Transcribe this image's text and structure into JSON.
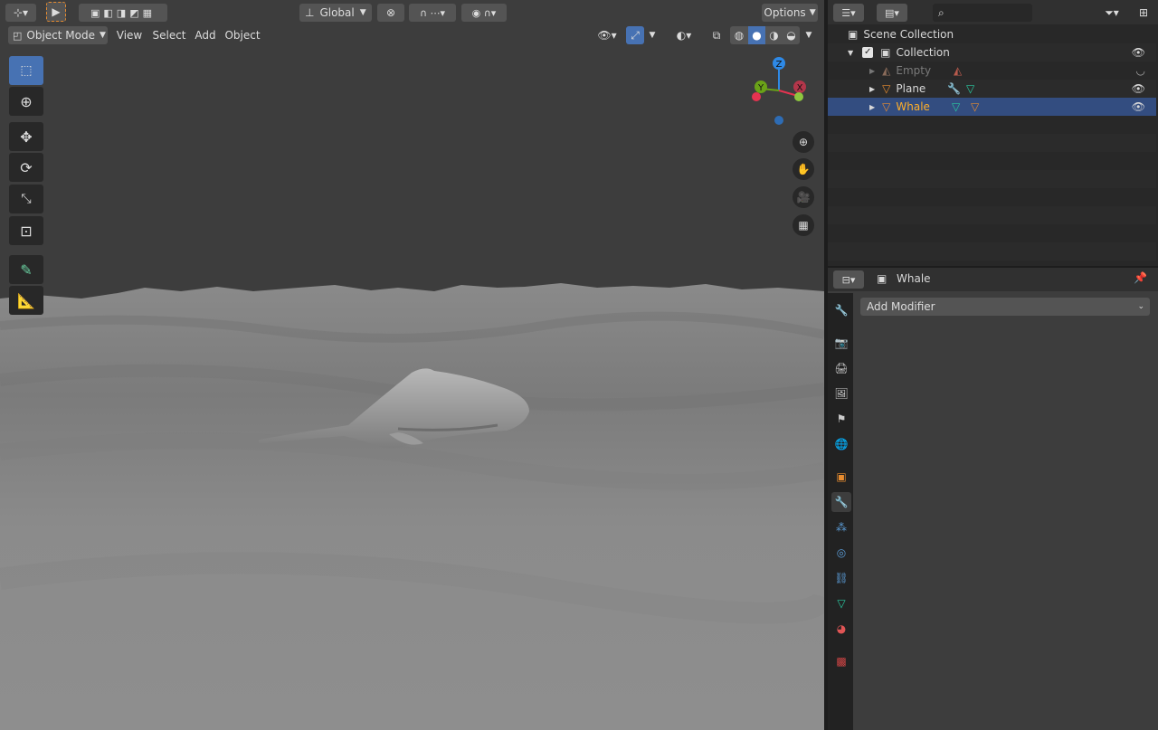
{
  "viewport": {
    "header": {
      "global_label": "Global",
      "options_label": "Options",
      "mode_label": "Object Mode",
      "menus": [
        "View",
        "Select",
        "Add",
        "Object"
      ]
    },
    "gizmo": {
      "z": "Z",
      "y": "Y",
      "x": "X"
    }
  },
  "outliner": {
    "root": "Scene Collection",
    "collection": "Collection",
    "items": [
      {
        "label": "Empty",
        "state": "hidden"
      },
      {
        "label": "Plane",
        "state": "normal"
      },
      {
        "label": "Whale",
        "state": "active"
      }
    ]
  },
  "properties": {
    "object_name": "Whale",
    "add_modifier_label": "Add Modifier",
    "tabs": [
      "tool",
      "render",
      "output",
      "view-layer",
      "scene",
      "world",
      "object",
      "modifiers",
      "particles",
      "physics",
      "constraints",
      "data",
      "material",
      "texture"
    ],
    "active_tab": "modifiers"
  },
  "colors": {
    "accent": "#4772b3",
    "active_text": "#ffaf29",
    "mesh": "#29c9a0",
    "object_orange": "#e88c2f",
    "axis_x": "#e53350",
    "axis_y": "#6aa218",
    "axis_z": "#2e89e6"
  }
}
